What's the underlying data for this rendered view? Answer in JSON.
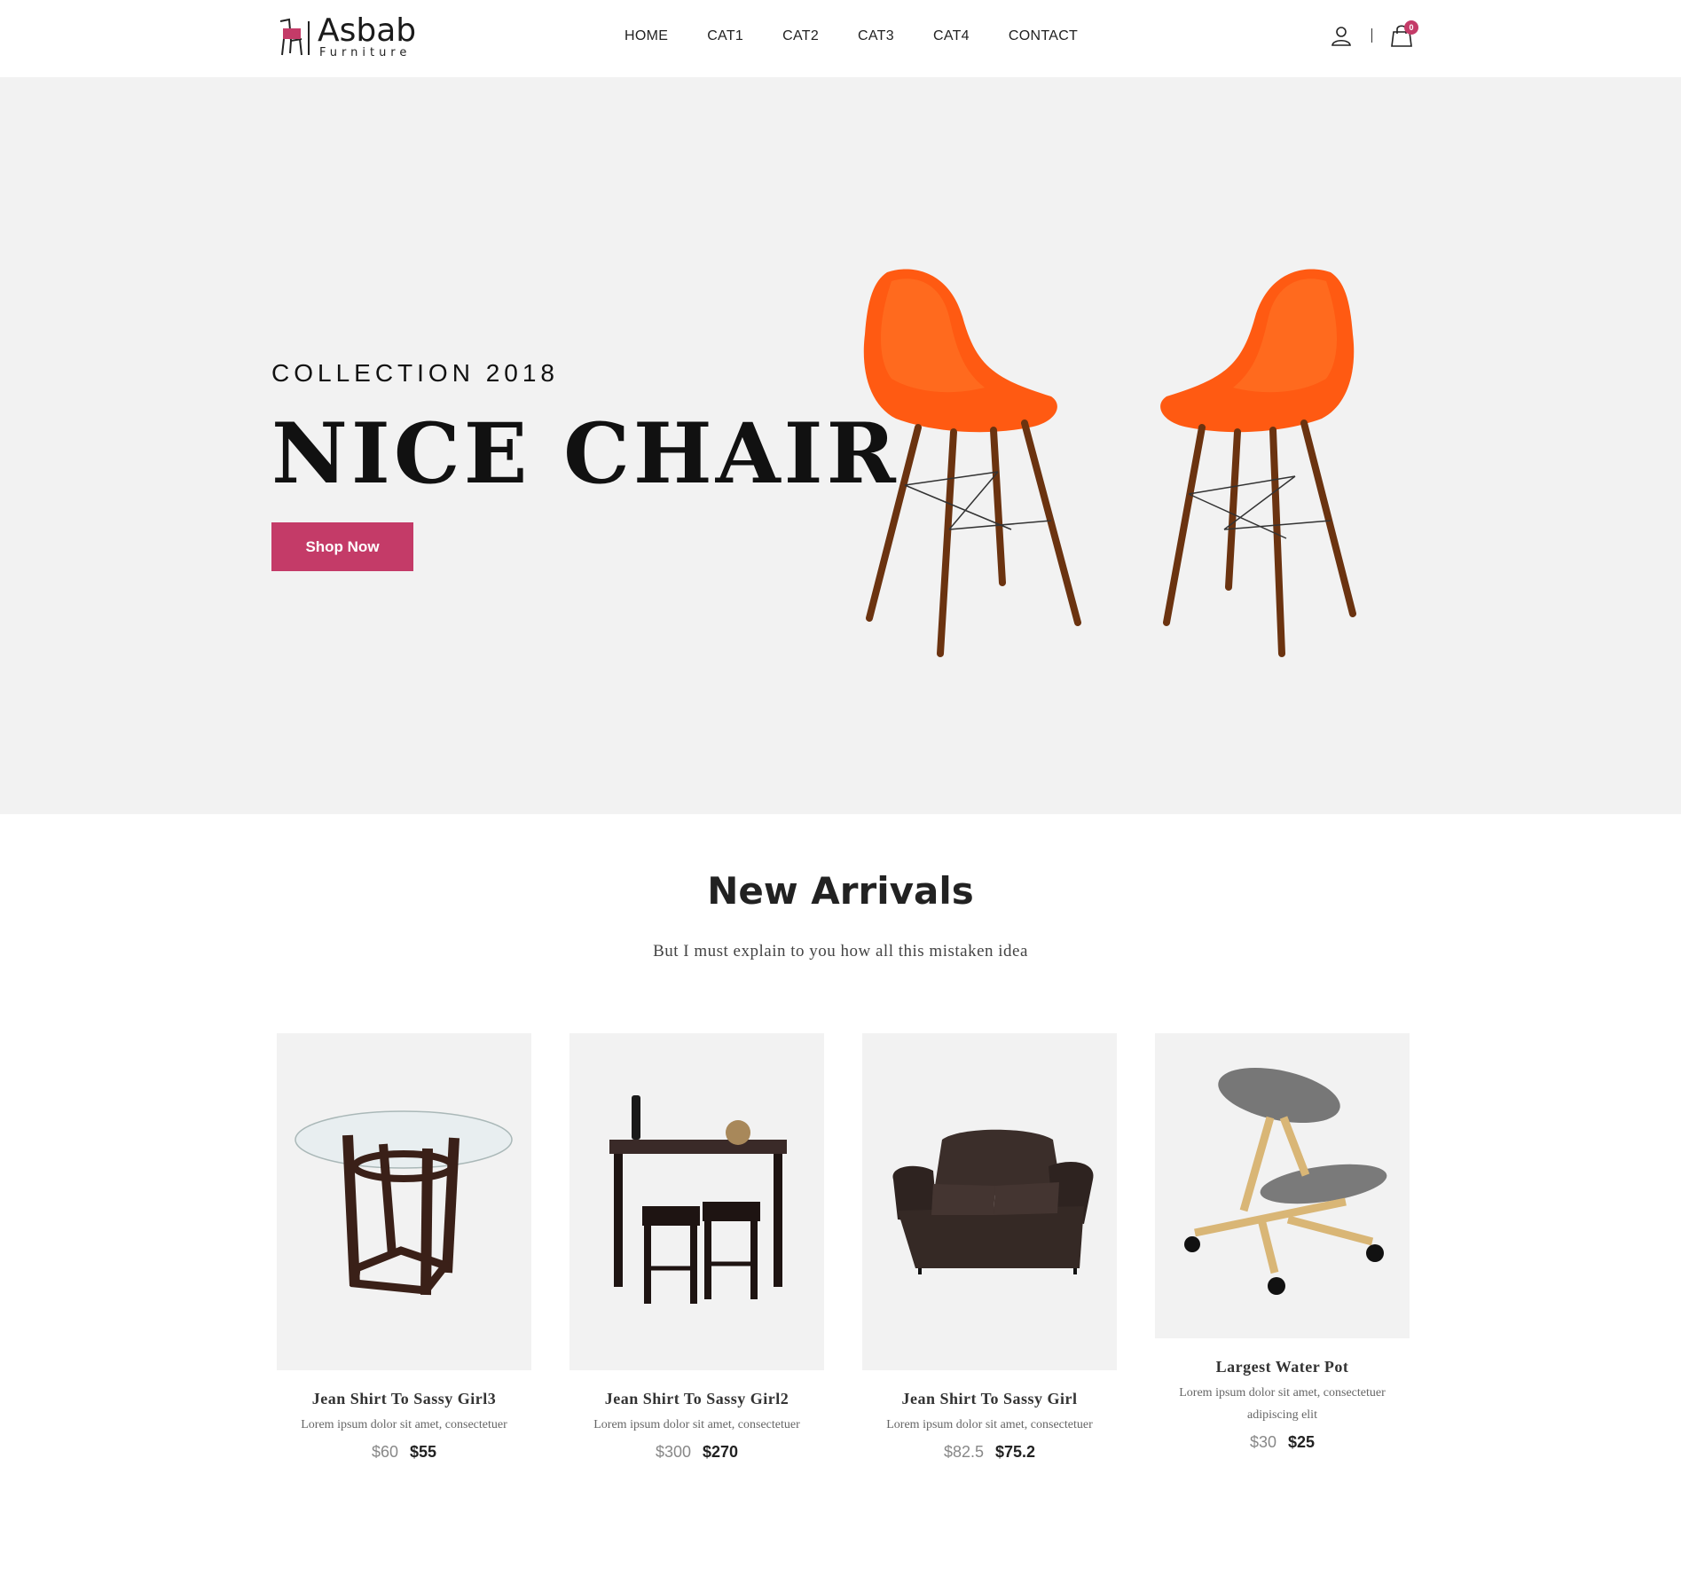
{
  "brand": {
    "name": "Asbab",
    "tagline": "Furniture",
    "accent": "#c43b68"
  },
  "nav": [
    {
      "label": "HOME"
    },
    {
      "label": "CAT1"
    },
    {
      "label": "CAT2"
    },
    {
      "label": "CAT3"
    },
    {
      "label": "CAT4"
    },
    {
      "label": "CONTACT"
    }
  ],
  "cart": {
    "count": "0"
  },
  "hero": {
    "eyebrow": "COLLECTION 2018",
    "title": "NICE CHAIR",
    "button": "Shop Now",
    "image": "orange-chairs"
  },
  "arrivals": {
    "title": "New Arrivals",
    "subtitle": "But I must explain to you how all this mistaken idea",
    "products": [
      {
        "name": "Jean Shirt To Sassy Girl3",
        "desc": "Lorem ipsum dolor sit amet, consectetuer",
        "old_price": "$60",
        "price": "$55",
        "image": "glass-round-table"
      },
      {
        "name": "Jean Shirt To Sassy Girl2",
        "desc": "Lorem ipsum dolor sit amet, consectetuer",
        "old_price": "$300",
        "price": "$270",
        "image": "bar-table-stools"
      },
      {
        "name": "Jean Shirt To Sassy Girl",
        "desc": "Lorem ipsum dolor sit amet, consectetuer",
        "old_price": "$82.5",
        "price": "$75.2",
        "image": "leather-loveseat"
      },
      {
        "name": "Largest Water Pot",
        "desc": "Lorem ipsum dolor sit amet, consectetuer adipiscing elit",
        "old_price": "$30",
        "price": "$25",
        "image": "kneeling-chair"
      }
    ]
  }
}
